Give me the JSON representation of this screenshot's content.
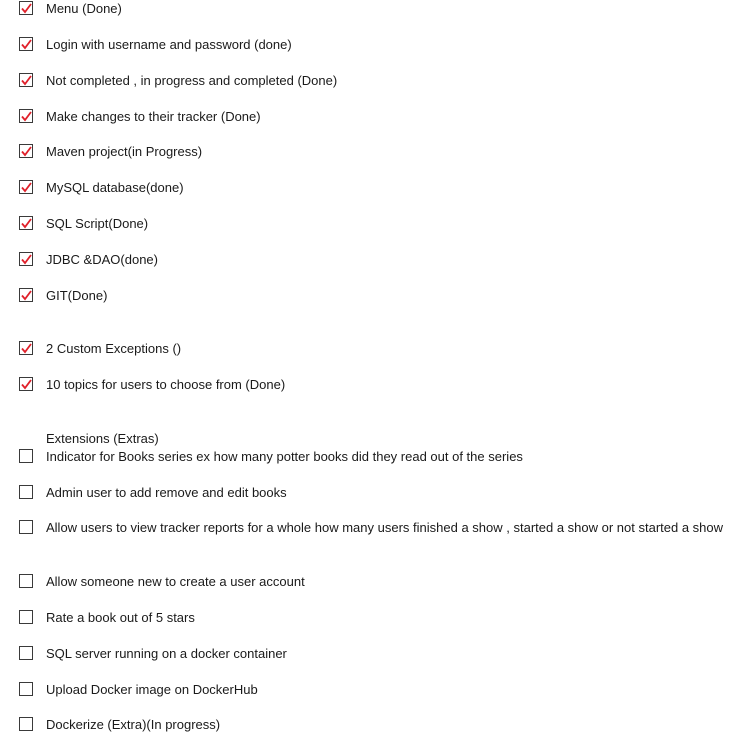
{
  "tasks": [
    {
      "label": "Menu (Done)",
      "checked": true
    },
    {
      "label": "Login with username and password (done)",
      "checked": true
    },
    {
      "label": "Not completed , in progress and completed (Done)",
      "checked": true
    },
    {
      "label": "Make changes to their tracker (Done)",
      "checked": true
    },
    {
      "label": "Maven project(in Progress)",
      "checked": true
    },
    {
      "label": "MySQL database(done)",
      "checked": true
    },
    {
      "label": "SQL Script(Done)",
      "checked": true
    },
    {
      "label": "JDBC &DAO(done)",
      "checked": true
    },
    {
      "label": "GIT(Done)",
      "checked": true
    },
    {
      "label": "2 Custom Exceptions ()",
      "checked": true
    },
    {
      "label": "10 topics for users to choose from (Done)",
      "checked": true
    }
  ],
  "extensions": {
    "heading": "Extensions (Extras)",
    "items": [
      {
        "label": "Indicator for Books series ex how many potter books did they read out of the series",
        "checked": false
      },
      {
        "label": "Admin user to add remove and edit books",
        "checked": false
      },
      {
        "label": "Allow users to view tracker reports for a whole how many users finished a show , started a show or not started a show",
        "checked": false
      },
      {
        "label": "Allow someone new to create a user account",
        "checked": false
      },
      {
        "label": "Rate a book out of 5 stars",
        "checked": false
      },
      {
        "label": "SQL server running on a docker container",
        "checked": false
      },
      {
        "label": "Upload Docker image on DockerHub",
        "checked": false
      },
      {
        "label": "Dockerize (Extra)(In progress)",
        "checked": false
      }
    ]
  },
  "colors": {
    "checkmark": "#e0202a",
    "border": "#3a3a3a"
  }
}
